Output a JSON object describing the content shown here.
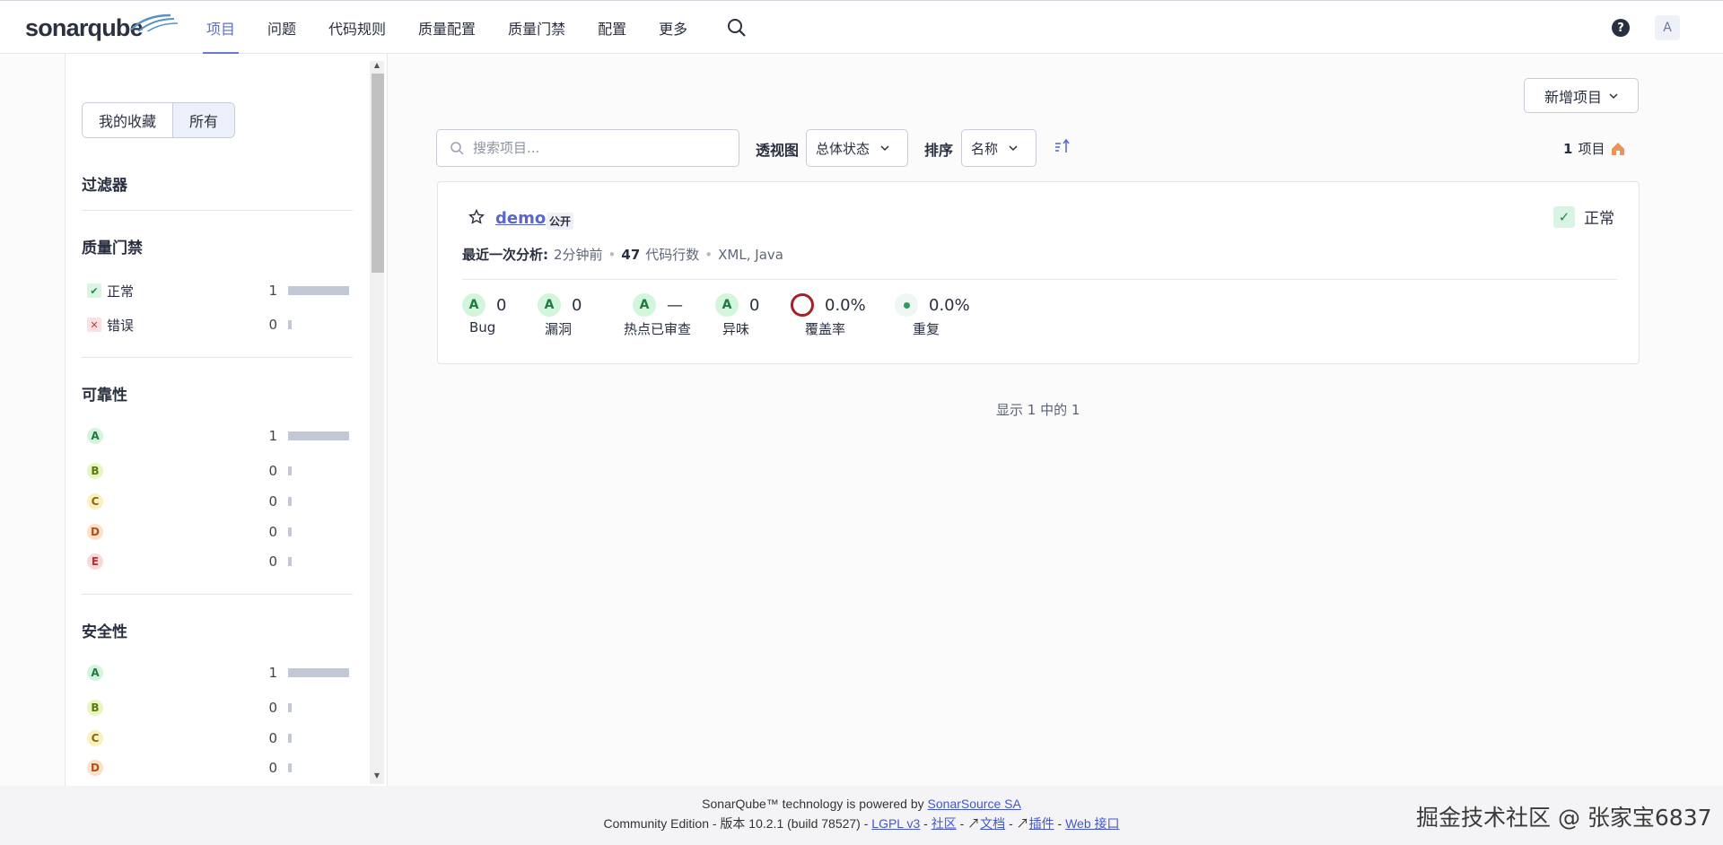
{
  "app": {
    "logo_text": "sonarqube"
  },
  "nav": {
    "items": [
      "项目",
      "问题",
      "代码规则",
      "质量配置",
      "质量门禁",
      "配置",
      "更多"
    ],
    "active": 0,
    "help_glyph": "?",
    "avatar_letter": "A"
  },
  "sidebar": {
    "toggle": {
      "favorites": "我的收藏",
      "all": "所有",
      "selected": "all"
    },
    "filters_title": "过滤器",
    "quality_gate": {
      "title": "质量门禁",
      "rows": [
        {
          "label": "正常",
          "count": "1",
          "fill": 1.0
        },
        {
          "label": "错误",
          "count": "0",
          "fill": 0
        }
      ]
    },
    "reliability": {
      "title": "可靠性",
      "rows": [
        {
          "grade": "A",
          "count": "1",
          "fill": 1.0
        },
        {
          "grade": "B",
          "count": "0",
          "fill": 0
        },
        {
          "grade": "C",
          "count": "0",
          "fill": 0
        },
        {
          "grade": "D",
          "count": "0",
          "fill": 0
        },
        {
          "grade": "E",
          "count": "0",
          "fill": 0
        }
      ]
    },
    "security": {
      "title": "安全性",
      "rows": [
        {
          "grade": "A",
          "count": "1",
          "fill": 1.0
        },
        {
          "grade": "B",
          "count": "0",
          "fill": 0
        },
        {
          "grade": "C",
          "count": "0",
          "fill": 0
        },
        {
          "grade": "D",
          "count": "0",
          "fill": 0
        }
      ]
    }
  },
  "toolbar": {
    "new_project": "新增项目",
    "search_placeholder": "搜索项目...",
    "perspective_label": "透视图",
    "perspective_value": "总体状态",
    "sort_label": "排序",
    "sort_value": "名称",
    "count_number": "1",
    "count_unit": "项目"
  },
  "project": {
    "name": "demo",
    "visibility": "公开",
    "quality_gate": "正常",
    "analysis_label": "最近一次分析:",
    "analysis_time": "2分钟前",
    "loc_value": "47",
    "loc_label": "代码行数",
    "languages": "XML, Java",
    "metrics": {
      "bugs": {
        "grade": "A",
        "value": "0",
        "label": "Bug"
      },
      "vulnerabilities": {
        "grade": "A",
        "value": "0",
        "label": "漏洞"
      },
      "hotspots": {
        "grade": "A",
        "value": "—",
        "label": "热点已审查"
      },
      "code_smells": {
        "grade": "A",
        "value": "0",
        "label": "异味"
      },
      "coverage": {
        "value": "0.0%",
        "label": "覆盖率"
      },
      "duplications": {
        "value": "0.0%",
        "label": "重复"
      }
    }
  },
  "showing": "显示 1 中的 1",
  "footer": {
    "powered_prefix": "SonarQube™ technology is powered by ",
    "powered_link": "SonarSource SA",
    "edition": "Community Edition - 版本 10.2.1 (build 78527) - ",
    "license": "LGPL v3",
    "community": "社区",
    "docs": "文档",
    "plugins": "插件",
    "web_api": "Web 接口",
    "signature": "掘金技术社区 @ 张家宝6837"
  },
  "colors": {
    "accent": "#5d6cd0",
    "grade_a": "#1e7a41",
    "coverage_ring": "#a3222a"
  }
}
